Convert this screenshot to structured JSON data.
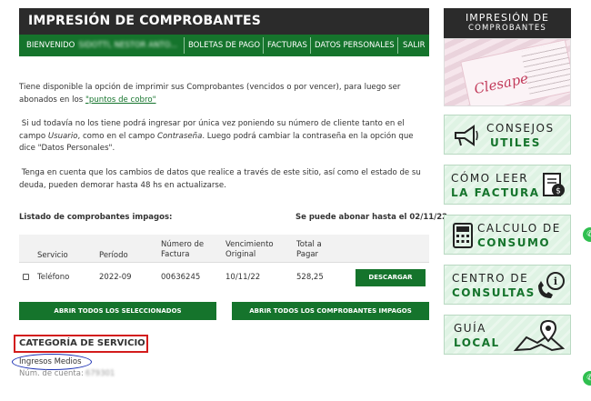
{
  "header": {
    "title": "IMPRESIÓN DE COMPROBANTES",
    "nav": [
      {
        "label": "BIENVENIDO",
        "redacted": "SIDOTTI, NESTOR ANTO..."
      },
      {
        "label": "BOLETAS DE PAGO"
      },
      {
        "label": "FACTURAS"
      },
      {
        "label": "DATOS PERSONALES"
      },
      {
        "label": "SALIR"
      }
    ]
  },
  "content": {
    "para1_a": "Tiene disponible la opción de imprimir sus Comprobantes (vencidos o por vencer), para luego ser abonados en los ",
    "para1_link": "\"puntos de cobro\"",
    "para2_a": "Si ud todavía no los tiene podrá ingresar por única vez poniendo su número de cliente tanto en el campo ",
    "para2_i1": "Usuario",
    "para2_b": ", como en el campo ",
    "para2_i2": "Contraseña",
    "para2_c": ". Luego podrá cambiar la contraseña en la opción que dice \"Datos Personales\".",
    "para3": "Tenga en cuenta que los cambios de datos que realice a través de este sitio, así como el estado de su deuda, pueden demorar hasta 48 hs en actualizarse.",
    "list_title": "Listado de comprobantes impagos:",
    "list_date": "Se puede abonar hasta el 02/11/22",
    "table": {
      "headers": [
        "Servicio",
        "Período",
        "Número de Factura",
        "Vencimiento Original",
        "Total a Pagar"
      ],
      "rows": [
        {
          "servicio": "Teléfono",
          "periodo": "2022-09",
          "numero": "00636245",
          "vencimiento": "10/11/22",
          "total": "528,25",
          "action": "DESCARGAR"
        }
      ]
    },
    "btn_selected": "ABRIR TODOS LOS SELECCIONADOS",
    "btn_all": "ABRIR TODOS LOS COMPROBANTES IMPAGOS",
    "category_title": "CATEGORÍA DE SERVICIO",
    "category_value": "Ingresos Medios",
    "account_label": "Núm. de cuenta:",
    "account_value": "679301"
  },
  "sidebar": {
    "top_title_1": "IMPRESIÓN DE",
    "top_title_2": "COMPROBANTES",
    "banner_logo": "Clesape",
    "cards": [
      {
        "l1": "CONSEJOS",
        "l2": "UTILES",
        "icon": "megaphone-icon"
      },
      {
        "l1": "CÓMO LEER",
        "l2": "LA FACTURA",
        "icon": "invoice-dollar-icon"
      },
      {
        "l1": "CALCULO DE",
        "l2": "CONSUMO",
        "icon": "calculator-icon"
      },
      {
        "l1": "CENTRO DE",
        "l2": "CONSULTAS",
        "icon": "phone-info-icon"
      },
      {
        "l1": "GUÍA",
        "l2": "LOCAL",
        "icon": "map-pin-icon"
      }
    ]
  },
  "colors": {
    "primary_green": "#15742c",
    "header_dark": "#2b2b2b",
    "highlight_red": "#d31c1c",
    "highlight_blue": "#1e33b5"
  }
}
